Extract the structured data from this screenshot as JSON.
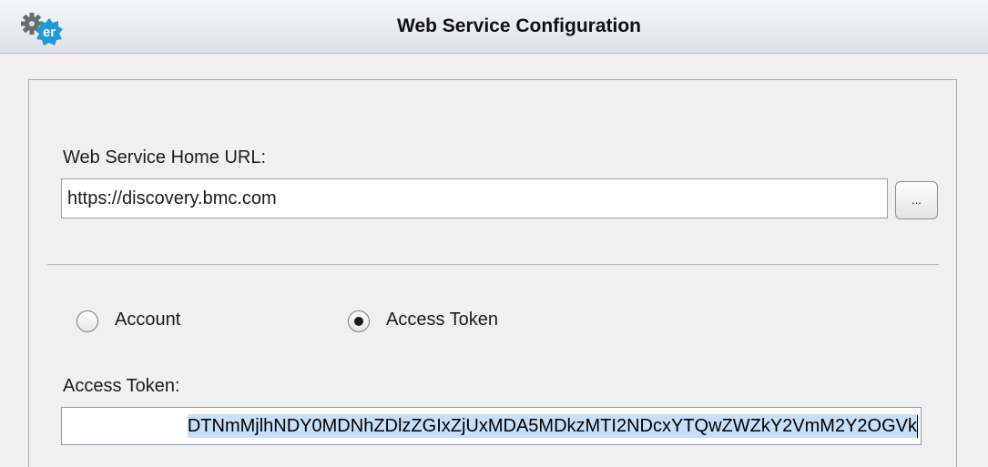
{
  "window": {
    "title": "Web Service Configuration",
    "app_icon": "gear-er-logo-icon"
  },
  "form": {
    "url_label": "Web Service Home URL:",
    "url_value": "https://discovery.bmc.com",
    "browse_label": "...",
    "auth_options": [
      {
        "label": "Account",
        "selected": false
      },
      {
        "label": "Access Token",
        "selected": true
      }
    ],
    "token_label": "Access Token:",
    "token_value": "DTNmMjlhNDY0MDNhZDlzZGIxZjUxMDA5MDkzMTI2NDcxYTQwZWZkY2VmM2Y2OGVk"
  },
  "colors": {
    "accent_blue": "#1e9ad6",
    "selection": "#c7e0fa",
    "background": "#f0f0f0"
  }
}
